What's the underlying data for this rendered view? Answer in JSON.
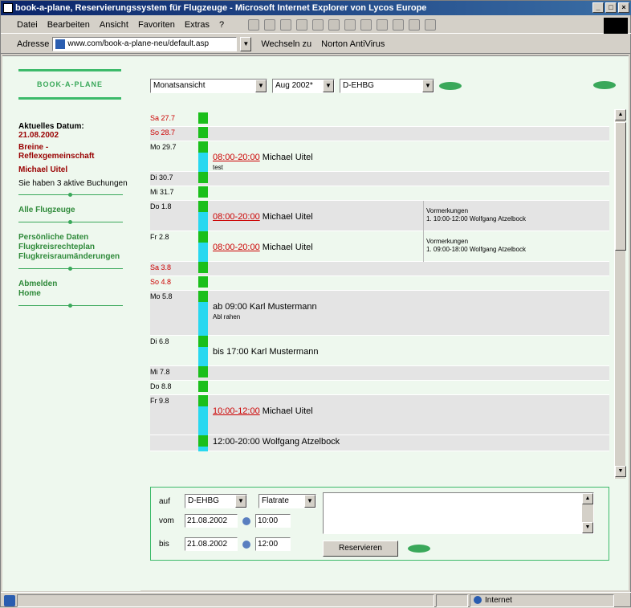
{
  "window": {
    "title": "book-a-plane, Reservierungssystem für Flugzeuge - Microsoft Internet Explorer von Lycos Europe",
    "controls": {
      "minimize": "_",
      "maximize": "□",
      "close": "×"
    }
  },
  "menu": [
    "Datei",
    "Bearbeiten",
    "Ansicht",
    "Favoriten",
    "Extras",
    "?"
  ],
  "address": {
    "label": "Adresse",
    "url": "www.com/book-a-plane-neu/default.asp",
    "go_label": "Wechseln zu",
    "links_label": "Norton AntiVirus"
  },
  "sidebar": {
    "logo": "BOOK-A-PLANE",
    "current_date_label": "Aktuelles Datum:",
    "current_date": "21.08.2002",
    "club_line1": "Breine -",
    "club_line2": "Reflexgemeinschaft",
    "user": "Michael Uitel",
    "bookings_note": "Sie haben 3 aktive Buchungen",
    "link_all_planes": "Alle Flugzeuge",
    "link_personal": "Persönliche Daten",
    "link_flight_times": "Flugkreisrechteplan",
    "link_changes": "Flugkreisraumänderungen",
    "link_logout": "Abmelden",
    "link_home": "Home"
  },
  "controls": {
    "view": "Monatsansicht",
    "month": "Aug 2002*",
    "aircraft": "D-EHBG"
  },
  "calendar": [
    {
      "day": "Sa 27.7",
      "weekend": true,
      "type": "green",
      "style": "plain"
    },
    {
      "day": "So 28.7",
      "weekend": true,
      "type": "green",
      "style": "alt"
    },
    {
      "day": "Mo 29.7",
      "weekend": false,
      "type": "cyan",
      "style": "plain",
      "time": "08:00-20:00",
      "name": "Michael Uitel",
      "sub": "test"
    },
    {
      "day": "Di 30.7",
      "weekend": false,
      "type": "green",
      "style": "alt"
    },
    {
      "day": "Mi 31.7",
      "weekend": false,
      "type": "green",
      "style": "plain"
    },
    {
      "day": "Do 1.8",
      "weekend": false,
      "type": "cyan",
      "style": "alt",
      "time": "08:00-20:00",
      "name": "Michael Uitel",
      "note1": "Vormerkungen",
      "note2": "1. 10:00-12:00 Wolfgang Atzelbock"
    },
    {
      "day": "Fr 2.8",
      "weekend": false,
      "type": "cyan",
      "style": "plain",
      "time": "08:00-20:00",
      "name": "Michael Uitel",
      "note1": "Vormerkungen",
      "note2": "1. 09:00-18:00 Wolfgang Atzelbock"
    },
    {
      "day": "Sa 3.8",
      "weekend": true,
      "type": "green",
      "style": "alt"
    },
    {
      "day": "So 4.8",
      "weekend": true,
      "type": "green",
      "style": "plain"
    },
    {
      "day": "Mo 5.8",
      "weekend": false,
      "type": "cyan",
      "style": "alt",
      "time": "",
      "name": "ab 09:00 Karl Mustermann",
      "sub": "Abl rahen"
    },
    {
      "day": "Di 6.8",
      "weekend": false,
      "type": "cyan",
      "style": "plain",
      "time": "",
      "name": "bis 17:00 Karl Mustermann"
    },
    {
      "day": "Mi 7.8",
      "weekend": false,
      "type": "green",
      "style": "alt"
    },
    {
      "day": "Do 8.8",
      "weekend": false,
      "type": "green",
      "style": "plain"
    },
    {
      "day": "Fr 9.8",
      "weekend": false,
      "type": "cyan",
      "style": "alt",
      "time": "10:00-12:00",
      "name": "Michael Uitel"
    },
    {
      "day": "",
      "weekend": false,
      "type": "cyan",
      "style": "alt",
      "time": "",
      "name": "12:00-20:00 Wolfgang Atzelbock"
    }
  ],
  "form": {
    "label_aircraft": "auf",
    "aircraft": "D-EHBG",
    "type": "Flatrate",
    "label_from": "vom",
    "from_date": "21.08.2002",
    "from_time": "10:00",
    "label_to": "bis",
    "to_date": "21.08.2002",
    "to_time": "12:00",
    "reserve_button": "Reservieren"
  },
  "status": {
    "zone": "Internet"
  },
  "colors": {
    "free": "#1bbf1b",
    "booked": "#28d8f0",
    "accent": "#3aa85a",
    "weekend": "#cc0000"
  }
}
